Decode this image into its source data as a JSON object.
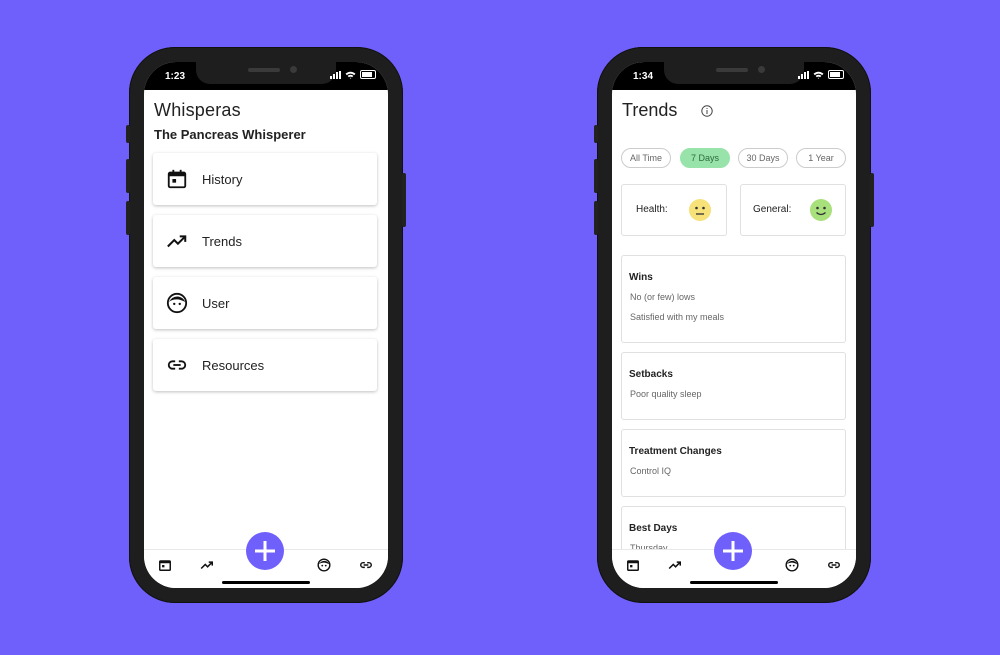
{
  "colors": {
    "background": "#7060fb",
    "fab": "#7060fb",
    "chip_active": "#97e3a9",
    "face_neutral": "#f7e179",
    "face_happy": "#a8e07c"
  },
  "left_phone": {
    "status_time": "1:23",
    "app_title": "Whisperas",
    "app_subtitle": "The Pancreas Whisperer",
    "menu": [
      {
        "label": "History",
        "icon": "calendar-icon"
      },
      {
        "label": "Trends",
        "icon": "trending-up-icon"
      },
      {
        "label": "User",
        "icon": "face-icon"
      },
      {
        "label": "Resources",
        "icon": "link-icon"
      }
    ]
  },
  "right_phone": {
    "status_time": "1:34",
    "title": "Trends",
    "range_chips": [
      {
        "label": "All Time",
        "selected": false
      },
      {
        "label": "7 Days",
        "selected": true
      },
      {
        "label": "30 Days",
        "selected": false
      },
      {
        "label": "1 Year",
        "selected": false
      }
    ],
    "mood": {
      "health_label": "Health:",
      "health_face": "neutral-face-icon",
      "general_label": "General:",
      "general_face": "smiley-face-icon"
    },
    "cards": [
      {
        "title": "Wins",
        "items": [
          "No (or few) lows",
          "Satisfied with my meals"
        ]
      },
      {
        "title": "Setbacks",
        "items": [
          "Poor quality sleep"
        ]
      },
      {
        "title": "Treatment Changes",
        "items": [
          "Control IQ"
        ]
      },
      {
        "title": "Best Days",
        "items": [
          "Thursday"
        ]
      }
    ]
  },
  "bottom_nav": [
    "calendar-icon",
    "trending-up-icon",
    "add-icon",
    "face-icon",
    "link-icon"
  ]
}
